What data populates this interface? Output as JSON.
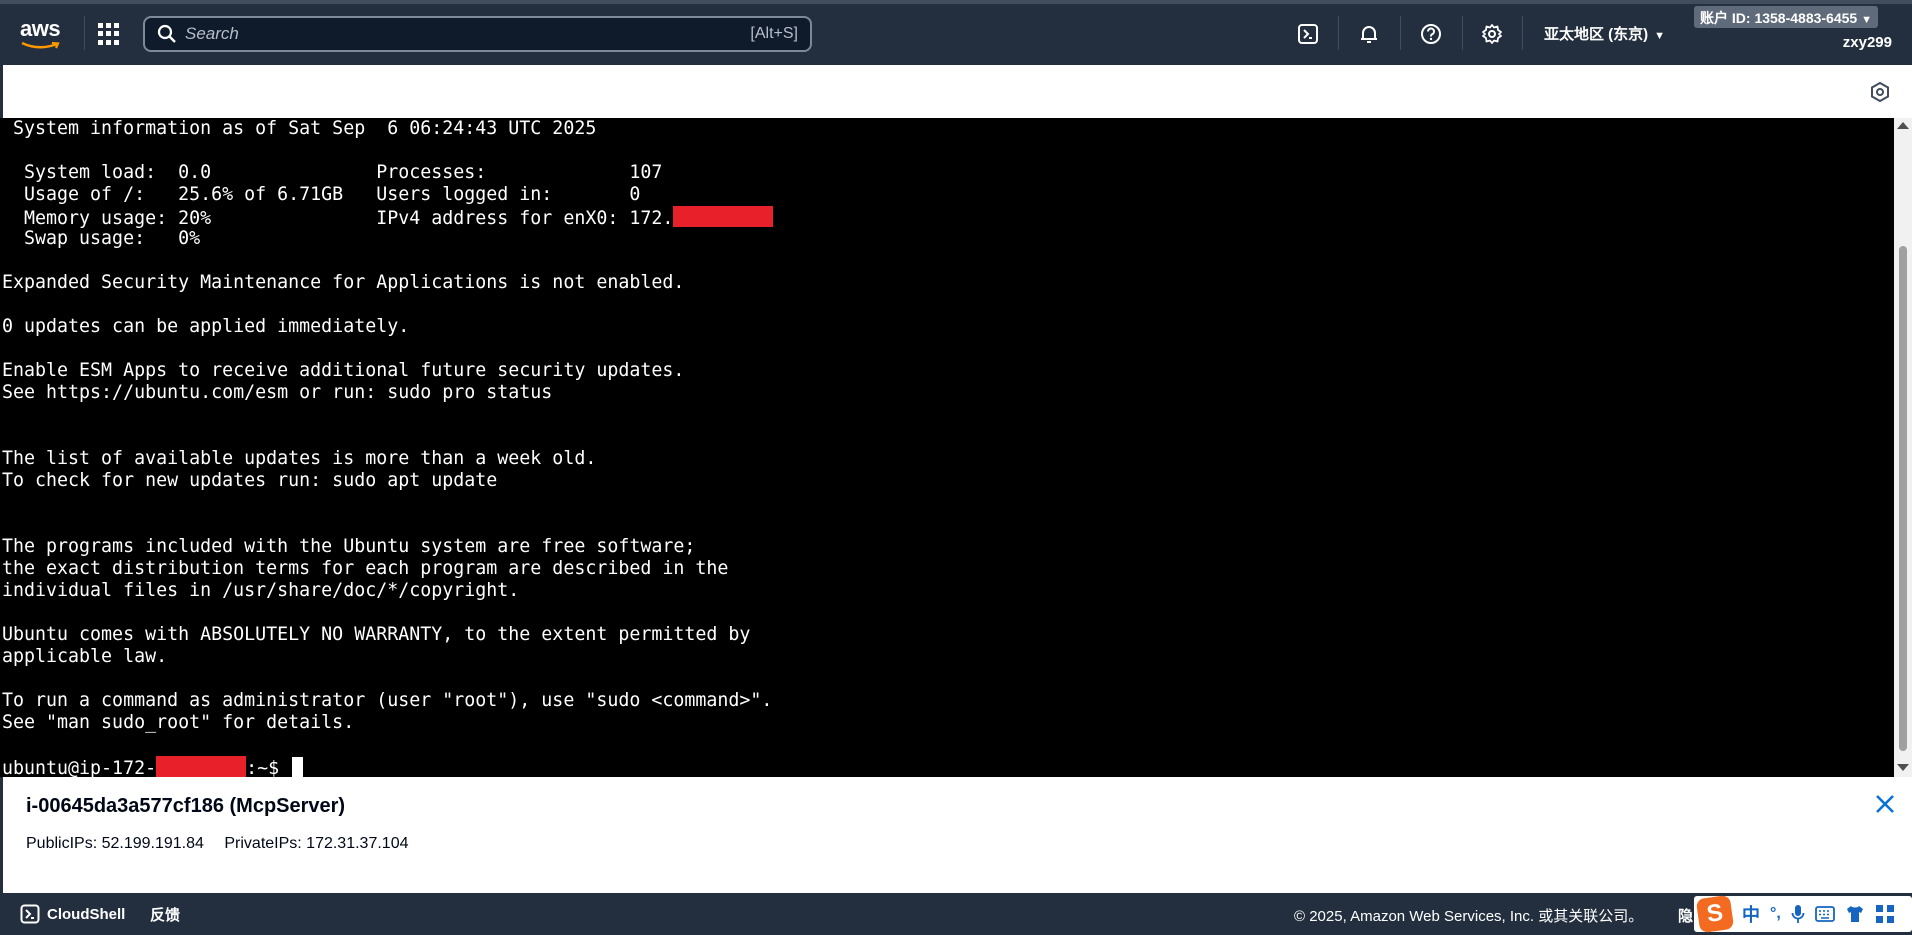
{
  "nav": {
    "logo_text": "aws",
    "search_placeholder": "Search",
    "search_shortcut": "[Alt+S]",
    "region": "亚太地区 (东京)",
    "account_label": "账户 ID: 1358-4883-6455",
    "username": "zxy299"
  },
  "terminal": {
    "lines": [
      " System information as of Sat Sep  6 06:24:43 UTC 2025",
      "",
      "  System load:  0.0               Processes:             107",
      "  Usage of /:   25.6% of 6.71GB   Users logged in:       0",
      "  Memory usage: 20%               IPv4 address for enX0: 172.",
      "  Swap usage:   0%",
      "",
      "Expanded Security Maintenance for Applications is not enabled.",
      "",
      "0 updates can be applied immediately.",
      "",
      "Enable ESM Apps to receive additional future security updates.",
      "See https://ubuntu.com/esm or run: sudo pro status",
      "",
      "",
      "The list of available updates is more than a week old.",
      "To check for new updates run: sudo apt update",
      "",
      "",
      "The programs included with the Ubuntu system are free software;",
      "the exact distribution terms for each program are described in the",
      "individual files in /usr/share/doc/*/copyright.",
      "",
      "Ubuntu comes with ABSOLUTELY NO WARRANTY, to the extent permitted by",
      "applicable law.",
      "",
      "To run a command as administrator (user \"root\"), use \"sudo <command>\".",
      "See \"man sudo_root\" for details.",
      ""
    ],
    "prompt_prefix": "ubuntu@ip-172-",
    "prompt_suffix": ":~$ ",
    "redaction_color": "#e8202a"
  },
  "instance": {
    "title": "i-00645da3a577cf186 (McpServer)",
    "public_ips": "PublicIPs: 52.199.191.84",
    "private_ips": "PrivateIPs: 172.31.37.104"
  },
  "footer": {
    "cloudshell": "CloudShell",
    "feedback": "反馈",
    "copyright": "© 2025, Amazon Web Services, Inc. 或其关联公司。",
    "privacy": "隐",
    "ime_logo": "S",
    "ime_lang": "中",
    "ime_punct": "°,"
  },
  "colors": {
    "nav_bg": "#232f3e",
    "accent_blue": "#0972d3",
    "terminal_bg": "#000000"
  },
  "icons": [
    "cloudshell-icon",
    "bell-icon",
    "help-icon",
    "settings-icon",
    "apps-grid-icon",
    "search-icon",
    "close-icon",
    "hex-icon"
  ]
}
